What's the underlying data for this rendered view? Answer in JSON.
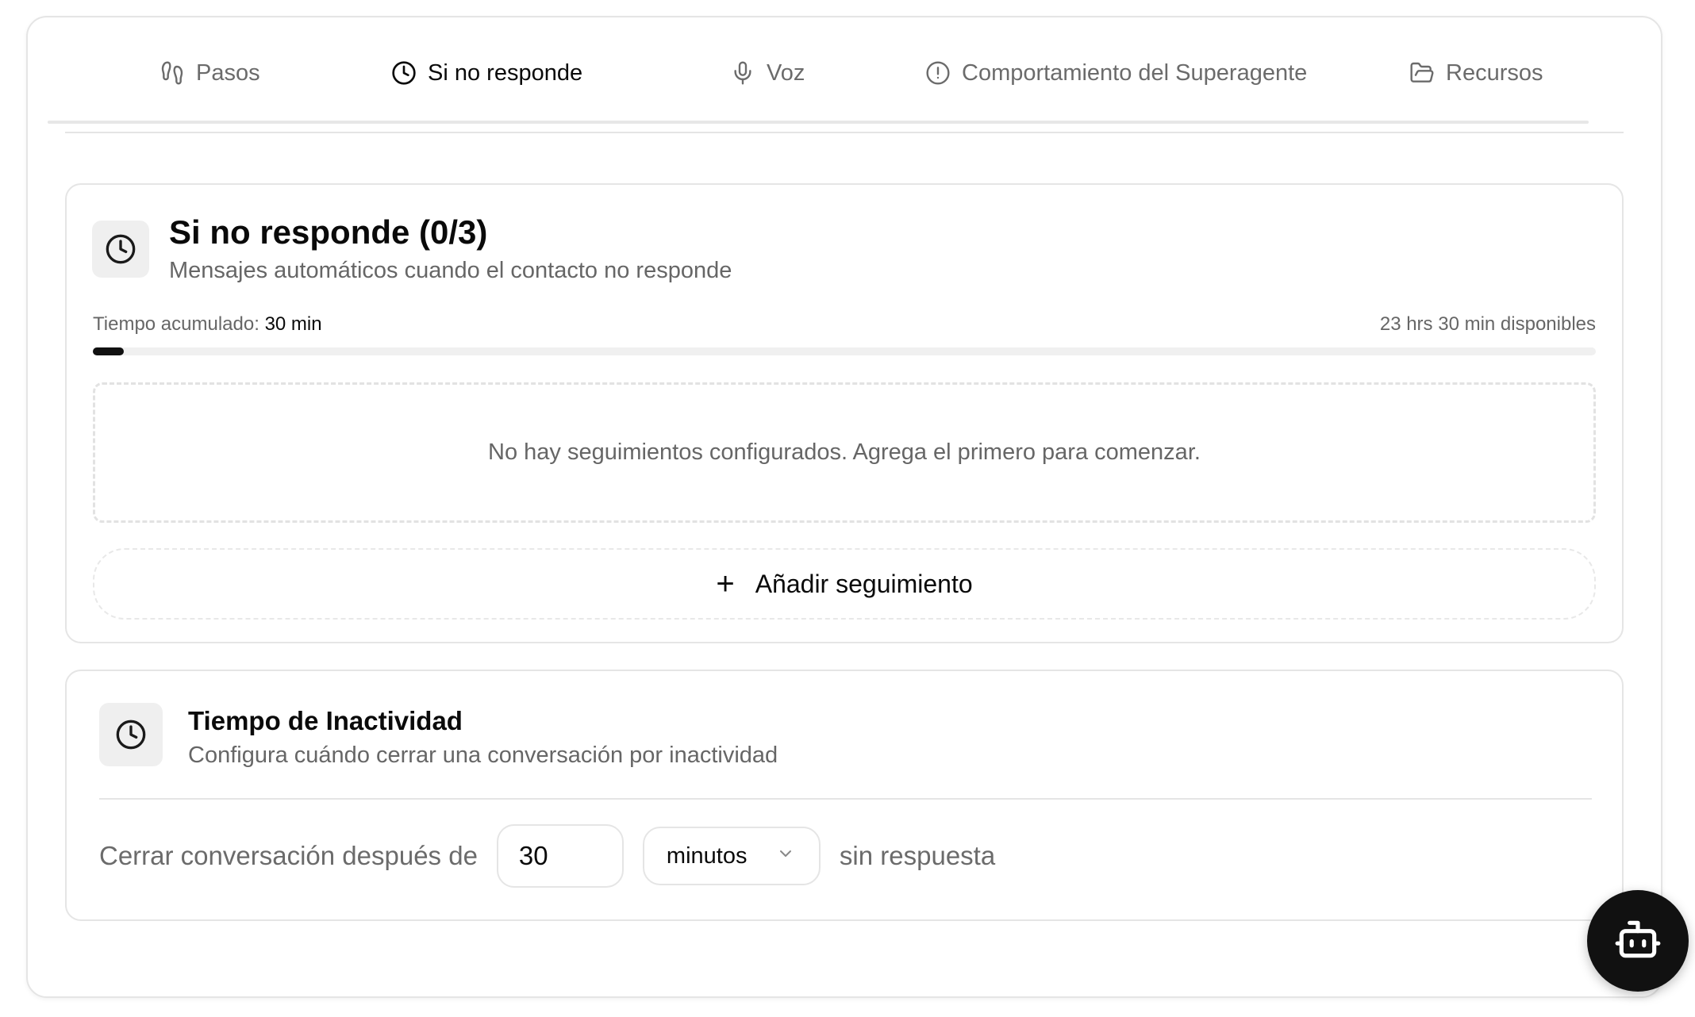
{
  "tabs": [
    {
      "label": "Pasos",
      "icon": "footprints-icon",
      "active": false
    },
    {
      "label": "Si no responde",
      "icon": "clock-icon",
      "active": true
    },
    {
      "label": "Voz",
      "icon": "mic-icon",
      "active": false
    },
    {
      "label": "Comportamiento del Superagente",
      "icon": "alert-circle-icon",
      "active": false
    },
    {
      "label": "Recursos",
      "icon": "folder-open-icon",
      "active": false
    }
  ],
  "followups": {
    "title": "Si no responde (0/3)",
    "subtitle": "Mensajes automáticos cuando el contacto no responde",
    "accumulated_label": "Tiempo acumulado:",
    "accumulated_value": "30 min",
    "available": "23 hrs 30 min disponibles",
    "progress_fraction": 0.0208,
    "empty_message": "No hay seguimientos configurados. Agrega el primero para comenzar.",
    "add_label": "Añadir seguimiento"
  },
  "inactivity": {
    "title": "Tiempo de Inactividad",
    "subtitle": "Configura cuándo cerrar una conversación por inactividad",
    "prefix": "Cerrar conversación después de",
    "value": "30",
    "unit": "minutos",
    "suffix": "sin respuesta"
  },
  "colors": {
    "accent": "#111111",
    "muted_text": "#6b6b6b",
    "border": "#e5e5e5"
  }
}
